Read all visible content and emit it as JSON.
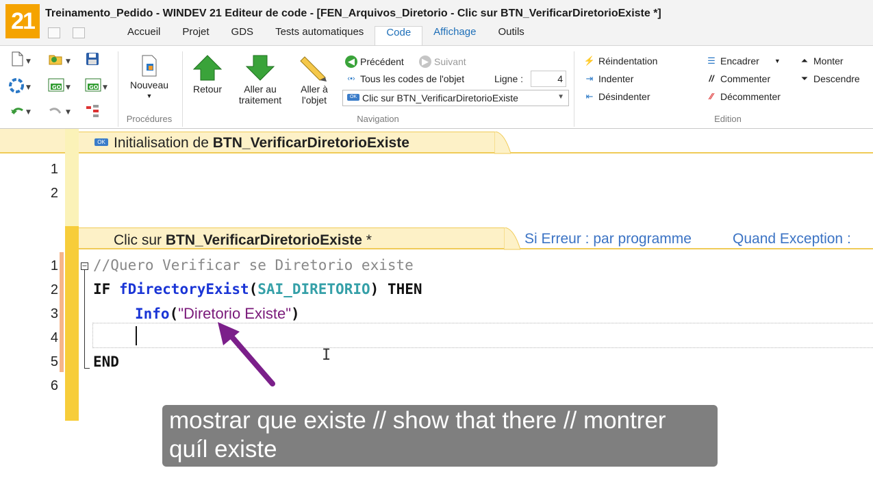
{
  "app": {
    "logo": "21",
    "title": "Treinamento_Pedido - WINDEV 21  Editeur de code - [FEN_Arquivos_Diretorio - Clic sur BTN_VerificarDiretorioExiste *]"
  },
  "menu": {
    "tabs": [
      "Accueil",
      "Projet",
      "GDS",
      "Tests automatiques",
      "Code",
      "Affichage",
      "Outils"
    ],
    "active_tab": "Code"
  },
  "ribbon": {
    "procedures": {
      "nouveau_label": "Nouveau",
      "group_label": "Procédures"
    },
    "navigation": {
      "retour_label": "Retour",
      "aller_traitement_label": "Aller au traitement",
      "aller_objet_label": "Aller à l'objet",
      "precedent_label": "Précédent",
      "suivant_label": "Suivant",
      "tous_codes_label": "Tous les codes de l'objet",
      "ligne_label": "Ligne :",
      "ligne_value": "4",
      "event_select_value": "Clic sur BTN_VerificarDiretorioExiste",
      "group_label": "Navigation"
    },
    "edition": {
      "reindentation_label": "Réindentation",
      "indenter_label": "Indenter",
      "desindenter_label": "Désindenter",
      "encadrer_label": "Encadrer",
      "commenter_label": "Commenter",
      "decommenter_label": "Décommenter",
      "monter_label": "Monter",
      "descendre_label": "Descendre",
      "group_label": "Edition"
    }
  },
  "editor": {
    "init_section": {
      "prefix": "Initialisation de ",
      "object": "BTN_VerificarDiretorioExiste",
      "line_numbers": [
        "1",
        "2"
      ]
    },
    "click_section": {
      "prefix": "Clic sur ",
      "object": "BTN_VerificarDiretorioExiste",
      "modified_mark": " *",
      "error_mode": "Si Erreur : par programme",
      "exception_mode": "Quand Exception :",
      "line_numbers": [
        "1",
        "2",
        "3",
        "4",
        "5",
        "6"
      ],
      "code": {
        "line1_comment": "//Quero Verificar se Diretorio existe",
        "line2_if": "IF",
        "line2_func": "fDirectoryExist",
        "line2_open": "(",
        "line2_var": "SAI_DIRETORIO",
        "line2_close": ")",
        "line2_then": "THEN",
        "line3_func": "Info",
        "line3_open": "(",
        "line3_string": "\"Diretorio Existe\"",
        "line3_close": ")",
        "line5_end": "END"
      }
    }
  },
  "caption": {
    "text": "mostrar que existe // show that there  // montrer quíl existe"
  },
  "colors": {
    "logo": "#f5a300",
    "section_header": "#fdf1c7",
    "gutter_accent": "#f7cd3a",
    "keyword_function": "#1a35d6",
    "variable": "#35a0a8",
    "string": "#7a1a7a",
    "annotation_arrow": "#7b1f8a",
    "caption_bg": "#7f7f7f"
  }
}
